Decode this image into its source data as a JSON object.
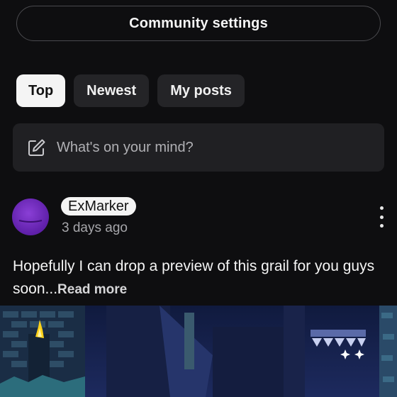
{
  "settings_button": {
    "label": "Community settings"
  },
  "tabs": [
    {
      "label": "Top",
      "active": true
    },
    {
      "label": "Newest",
      "active": false
    },
    {
      "label": "My posts",
      "active": false
    }
  ],
  "compose": {
    "placeholder": "What's on your mind?",
    "icon": "edit-icon"
  },
  "post": {
    "author": "ExMarker",
    "time": "3 days ago",
    "text": "Hopefully I can drop a preview of this grail for you guys soon...",
    "read_more": "Read more",
    "menu_icon": "more-vertical-icon"
  },
  "colors": {
    "background": "#0e0e10",
    "surface": "#202023",
    "avatar": "#7b2fd0",
    "image_blue": "#1e2a5c"
  }
}
